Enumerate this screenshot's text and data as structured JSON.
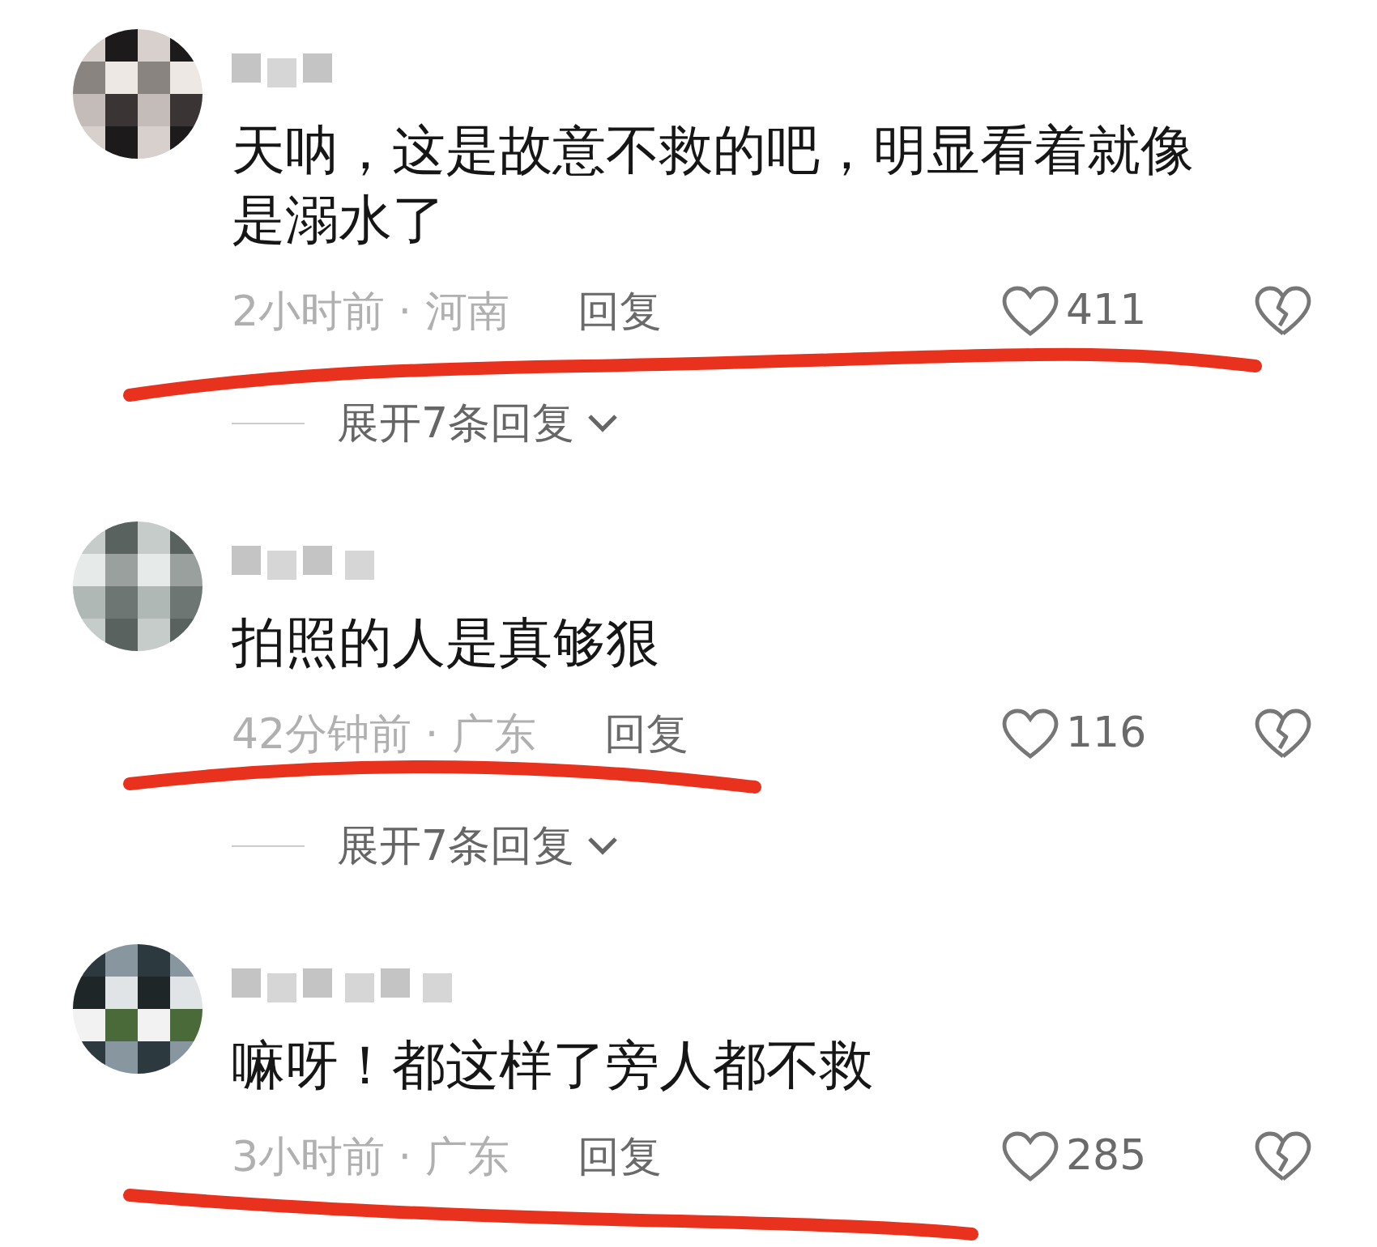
{
  "comments": [
    {
      "username": {
        "kind": "pixelated"
      },
      "text": "天呐，这是故意不救的吧，明显看着就像是溺水了",
      "time_location": "2小时前 · 河南",
      "reply": "回复",
      "likes": "411",
      "expand": "展开7条回复",
      "underlined": true
    },
    {
      "username": {
        "kind": "pixelated"
      },
      "text": "拍照的人是真够狠",
      "time_location": "42分钟前 · 广东",
      "reply": "回复",
      "likes": "116",
      "expand": "展开7条回复",
      "underlined": true
    },
    {
      "username": {
        "kind": "pixelated"
      },
      "text": "嘛呀！都这样了旁人都不救",
      "time_location": "3小时前 · 广东",
      "reply": "回复",
      "likes": "285",
      "underlined": true
    }
  ]
}
